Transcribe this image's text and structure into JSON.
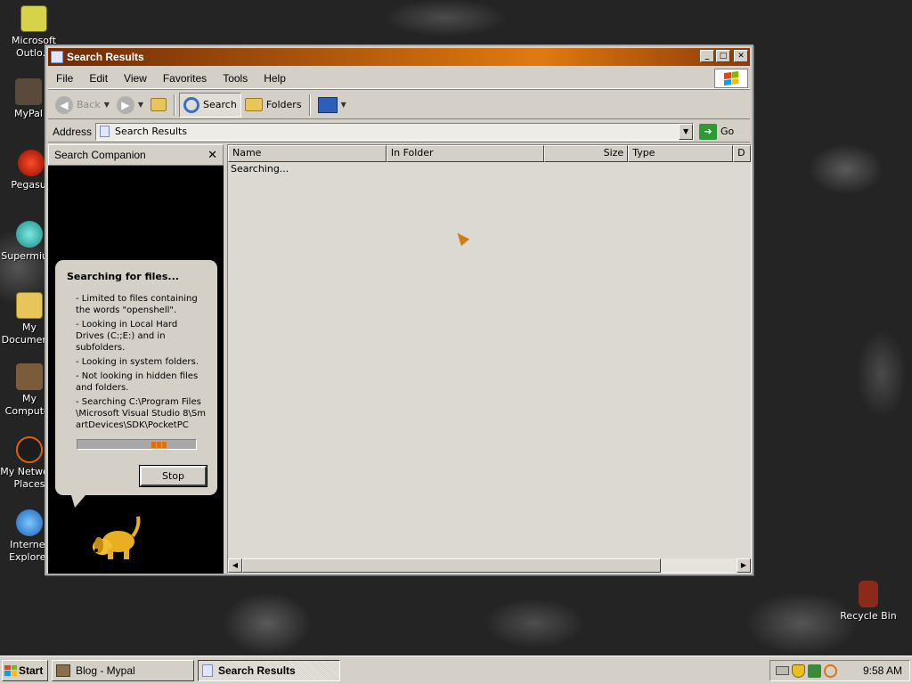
{
  "desktop": {
    "icons": [
      {
        "label": "Microsoft Outlo...",
        "icon": "outlook-icon"
      },
      {
        "label": "MyPal",
        "icon": "mypal-icon"
      },
      {
        "label": "Pegasus",
        "icon": "pegasus-icon"
      },
      {
        "label": "Supermium",
        "icon": "supermium-icon"
      },
      {
        "label": "My Documents",
        "icon": "my-documents-icon"
      },
      {
        "label": "My Computer",
        "icon": "my-computer-icon"
      },
      {
        "label": "My Network Places",
        "icon": "network-places-icon"
      },
      {
        "label": "Internet Explorer",
        "icon": "internet-explorer-icon"
      },
      {
        "label": "Recycle Bin",
        "icon": "recycle-bin-icon"
      }
    ]
  },
  "window": {
    "title": "Search Results",
    "controls": {
      "minimize": "_",
      "maximize": "□",
      "close": "✕"
    },
    "menu": [
      "File",
      "Edit",
      "View",
      "Favorites",
      "Tools",
      "Help"
    ],
    "toolbar": {
      "back": "Back",
      "search": "Search",
      "folders": "Folders"
    },
    "address": {
      "label": "Address",
      "value": "Search Results",
      "go": "Go"
    }
  },
  "companion": {
    "title": "Search Companion",
    "close": "✕",
    "balloon_title": "Searching for files...",
    "items": [
      "- Limited to files containing the words \"openshell\".",
      "- Looking in Local Hard Drives (C:;E:) and in subfolders.",
      "- Looking in system folders.",
      "- Not looking in hidden files and folders.",
      "- Searching C:\\Program Files\\Microsoft Visual Studio 8\\SmartDevices\\SDK\\PocketPC"
    ],
    "stop": "Stop"
  },
  "results": {
    "columns": [
      "Name",
      "In Folder",
      "Size",
      "Type",
      "D"
    ],
    "status": "Searching..."
  },
  "taskbar": {
    "start": "Start",
    "tasks": [
      {
        "label": "Blog - Mypal",
        "active": false
      },
      {
        "label": "Search Results",
        "active": true
      }
    ],
    "time": "9:58 AM"
  },
  "colors": {
    "titlebar_start": "#6e2a05",
    "titlebar_mid": "#e07a10",
    "progress_block": "#e0700e"
  }
}
